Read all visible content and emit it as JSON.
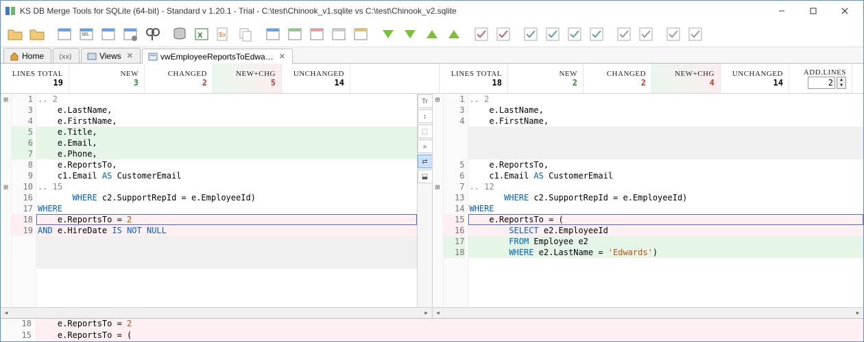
{
  "title": "KS DB Merge Tools for SQLite (64-bit) - Standard v 1.20.1 - Trial - C:\\test\\Chinook_v1.sqlite vs C:\\test\\Chinook_v2.sqlite",
  "tabs": [
    {
      "icon": "home",
      "label": "Home",
      "closable": false
    },
    {
      "icon": "xx",
      "label": "",
      "closable": false
    },
    {
      "icon": "views",
      "label": "Views",
      "closable": true
    },
    {
      "icon": "view",
      "label": "vwEmployeeReportsToEdwa…",
      "closable": true,
      "active": true
    }
  ],
  "left_stats": {
    "total_hdr": "LINES TOTAL",
    "total": "19",
    "new_hdr": "NEW",
    "new": "3",
    "changed_hdr": "CHANGED",
    "changed": "2",
    "newchg_hdr": "NEW+CHG",
    "newchg": "5",
    "unchanged_hdr": "UNCHANGED",
    "unchanged": "14"
  },
  "right_stats": {
    "total_hdr": "LINES TOTAL",
    "total": "18",
    "new_hdr": "NEW",
    "new": "2",
    "changed_hdr": "CHANGED",
    "changed": "2",
    "newchg_hdr": "NEW+CHG",
    "newchg": "4",
    "unchanged_hdr": "UNCHANGED",
    "unchanged": "14"
  },
  "addlines": {
    "hdr": "ADD.LINES",
    "value": "2"
  },
  "left_code": [
    {
      "ln": "1",
      "cls": "fold-hdr",
      "text": ".. 2",
      "fold": "⊞"
    },
    {
      "ln": "3",
      "cls": "",
      "text": "    e.LastName,"
    },
    {
      "ln": "4",
      "cls": "",
      "text": "    e.FirstName,"
    },
    {
      "ln": "5",
      "cls": "added-bg",
      "text": "    e.Title,"
    },
    {
      "ln": "6",
      "cls": "added-bg",
      "text": "    e.Email,"
    },
    {
      "ln": "7",
      "cls": "added-bg",
      "text": "    e.Phone,"
    },
    {
      "ln": "8",
      "cls": "",
      "text": "    e.ReportsTo,"
    },
    {
      "ln": "9",
      "cls": "",
      "html": "    c1.Email <span class='kw'>AS</span> CustomerEmail"
    },
    {
      "ln": "10",
      "cls": "fold-hdr",
      "text": ".. 15",
      "fold": "⊞"
    },
    {
      "ln": "16",
      "cls": "",
      "html": "       <span class='kw'>WHERE</span> c2.SupportRepId = e.EmployeeId)"
    },
    {
      "ln": "17",
      "cls": "",
      "html": "<span class='kw'>WHERE</span>"
    },
    {
      "ln": "18",
      "cls": "changed-bg cursor",
      "html": "    e.ReportsTo = <span class='num'>2</span>"
    },
    {
      "ln": "19",
      "cls": "changed-bg",
      "html": "<span class='kw'>AND</span> e.HireDate <span class='kw'>IS NOT NULL</span>"
    },
    {
      "ln": "",
      "cls": "empty-bg",
      "text": " "
    },
    {
      "ln": "",
      "cls": "empty-bg",
      "text": " "
    },
    {
      "ln": "",
      "cls": "empty-bg",
      "text": " "
    }
  ],
  "right_code": [
    {
      "ln": "1",
      "cls": "fold-hdr",
      "text": ".. 2",
      "fold": "⊞"
    },
    {
      "ln": "3",
      "cls": "",
      "text": "    e.LastName,"
    },
    {
      "ln": "4",
      "cls": "",
      "text": "    e.FirstName,"
    },
    {
      "ln": "",
      "cls": "empty-bg",
      "text": " "
    },
    {
      "ln": "",
      "cls": "empty-bg",
      "text": " "
    },
    {
      "ln": "",
      "cls": "empty-bg",
      "text": " "
    },
    {
      "ln": "5",
      "cls": "",
      "text": "    e.ReportsTo,"
    },
    {
      "ln": "6",
      "cls": "",
      "html": "    c1.Email <span class='kw'>AS</span> CustomerEmail"
    },
    {
      "ln": "7",
      "cls": "fold-hdr",
      "text": ".. 12",
      "fold": "⊞"
    },
    {
      "ln": "13",
      "cls": "",
      "html": "       <span class='kw'>WHERE</span> c2.SupportRepId = e.EmployeeId)"
    },
    {
      "ln": "14",
      "cls": "",
      "html": "<span class='kw'>WHERE</span>"
    },
    {
      "ln": "15",
      "cls": "changed-bg cursor",
      "text": "    e.ReportsTo = ("
    },
    {
      "ln": "16",
      "cls": "changed-bg",
      "html": "        <span class='kw'>SELECT</span> e2.EmployeeId"
    },
    {
      "ln": "17",
      "cls": "added-bg",
      "html": "        <span class='kw'>FROM</span> Employee e2"
    },
    {
      "ln": "18",
      "cls": "added-bg",
      "html": "        <span class='kw'>WHERE</span> e2.LastName = <span class='str'>'Edwards'</span>)"
    },
    {
      "ln": "",
      "cls": "",
      "text": " "
    }
  ],
  "bottom": [
    {
      "ln": "18",
      "html": "    e.ReportsTo = <span class='num'>2</span>"
    },
    {
      "ln": "15",
      "text": "    e.ReportsTo = ("
    }
  ],
  "gutter_btns": [
    "Tr",
    "↕",
    "⬚",
    "»",
    "⇄",
    "⬓"
  ]
}
